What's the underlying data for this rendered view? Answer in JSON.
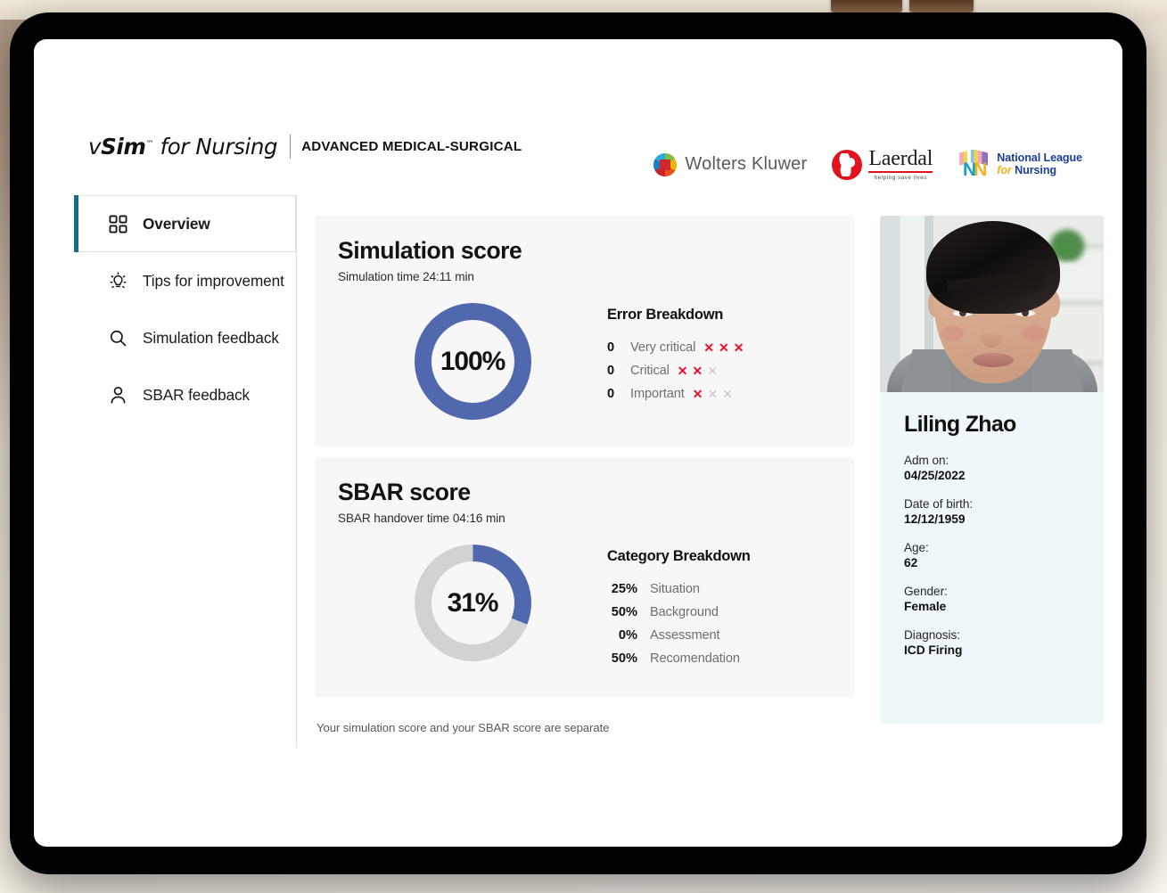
{
  "header": {
    "brand_prefix": "v",
    "brand_bold": "Sim",
    "brand_tm": "™",
    "brand_rest": " for Nursing",
    "brand_subtitle": "ADVANCED MEDICAL-SURGICAL",
    "logos": [
      {
        "name": "Wolters Kluwer",
        "text": "Wolters Kluwer"
      },
      {
        "name": "Laerdal",
        "text": "Laerdal",
        "tagline": "helping save lives"
      },
      {
        "name": "National League for Nursing",
        "line1": "National League",
        "line2_for": "for",
        "line2_rest": "Nursing",
        "monogram": "NN"
      }
    ]
  },
  "sidebar": {
    "items": [
      {
        "label": "Overview",
        "icon": "grid-icon",
        "active": true
      },
      {
        "label": "Tips for improvement",
        "icon": "lightbulb-icon",
        "active": false
      },
      {
        "label": "Simulation feedback",
        "icon": "search-icon",
        "active": false
      },
      {
        "label": "SBAR feedback",
        "icon": "person-icon",
        "active": false
      }
    ]
  },
  "main": {
    "simulation_card": {
      "title": "Simulation score",
      "subtitle": "Simulation time 24:11 min",
      "score_label": "100%",
      "breakdown_title": "Error Breakdown",
      "rows": [
        {
          "count": "0",
          "label": "Very critical",
          "marks_on": 3,
          "marks_total": 3
        },
        {
          "count": "0",
          "label": "Critical",
          "marks_on": 2,
          "marks_total": 3
        },
        {
          "count": "0",
          "label": "Important",
          "marks_on": 1,
          "marks_total": 3
        }
      ]
    },
    "sbar_card": {
      "title": "SBAR score",
      "subtitle": "SBAR handover time 04:16 min",
      "score_label": "31%",
      "breakdown_title": "Category Breakdown",
      "rows": [
        {
          "pct": "25%",
          "label": "Situation"
        },
        {
          "pct": "50%",
          "label": "Background"
        },
        {
          "pct": "0%",
          "label": "Assessment"
        },
        {
          "pct": "50%",
          "label": "Recomendation"
        }
      ]
    },
    "footnote": "Your simulation score and your SBAR score are separate"
  },
  "patient": {
    "name": "Liling Zhao",
    "fields": [
      {
        "key": "Adm on:",
        "value": "04/25/2022"
      },
      {
        "key": "Date of birth:",
        "value": "12/12/1959"
      },
      {
        "key": "Age:",
        "value": "62"
      },
      {
        "key": "Gender:",
        "value": "Female"
      },
      {
        "key": "Diagnosis:",
        "value": "ICD Firing"
      }
    ]
  },
  "chart_data": [
    {
      "type": "pie",
      "title": "Simulation score",
      "labels": [
        "Score",
        "Remaining"
      ],
      "values": [
        100,
        0
      ],
      "center_label": "100%",
      "colors": [
        "#5068ae",
        "#d2d2d2"
      ],
      "donut": true,
      "legend": "none"
    },
    {
      "type": "pie",
      "title": "SBAR score",
      "labels": [
        "Score",
        "Remaining"
      ],
      "values": [
        31,
        69
      ],
      "center_label": "31%",
      "colors": [
        "#5068ae",
        "#d2d2d2"
      ],
      "donut": true,
      "legend": "none"
    },
    {
      "type": "bar",
      "title": "Category Breakdown",
      "categories": [
        "Situation",
        "Background",
        "Assessment",
        "Recomendation"
      ],
      "values": [
        25,
        50,
        0,
        50
      ],
      "ylabel": "Percent",
      "ylim": [
        0,
        100
      ]
    },
    {
      "type": "table",
      "title": "Error Breakdown",
      "categories": [
        "Very critical",
        "Critical",
        "Important"
      ],
      "values": [
        0,
        0,
        0
      ]
    }
  ],
  "colors": {
    "accent_blue": "#5068ae",
    "track_gray": "#d2d2d2",
    "active_bar": "#18698c",
    "error_red": "#e8122b",
    "panel_cyan": "#eef8fb",
    "card_gray": "#f7f7f7"
  }
}
